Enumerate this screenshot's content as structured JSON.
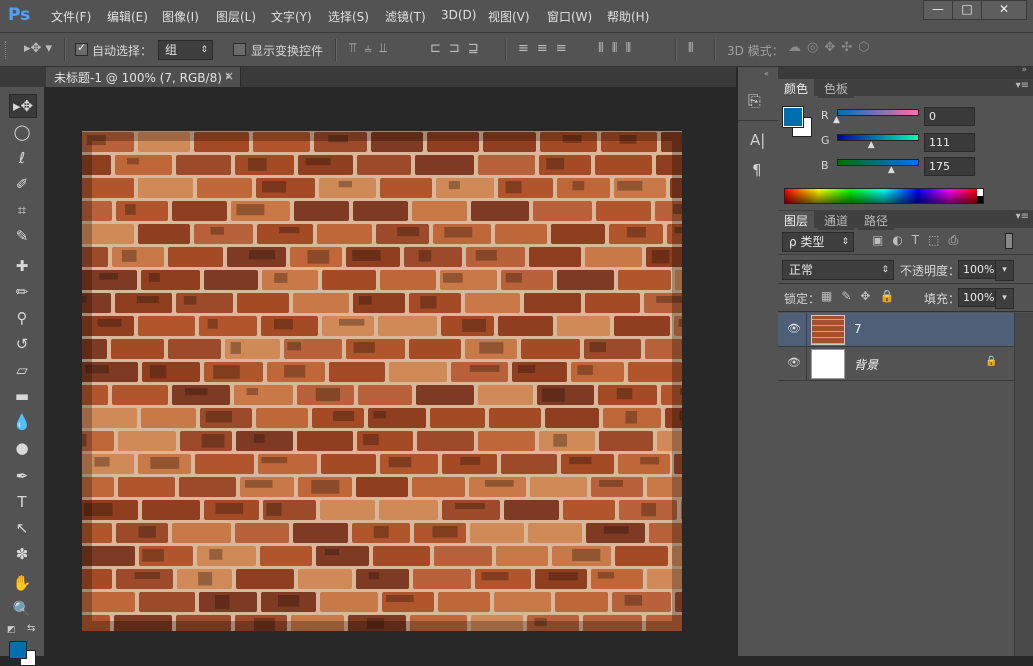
{
  "app": {
    "logo": "Ps"
  },
  "menu": [
    "文件(F)",
    "编辑(E)",
    "图像(I)",
    "图层(L)",
    "文字(Y)",
    "选择(S)",
    "滤镜(T)",
    "3D(D)",
    "视图(V)",
    "窗口(W)",
    "帮助(H)"
  ],
  "window_controls": {
    "minimize": "—",
    "maximize": "□",
    "close": "✕"
  },
  "options": {
    "auto_select_label": "自动选择：",
    "auto_select_checked": true,
    "target_value": "组",
    "show_transform_label": "显示变换控件",
    "mode_3d_label": "3D 模式："
  },
  "document": {
    "tab_title": "未标题-1 @ 100% (7, RGB/8) *",
    "close": "×"
  },
  "color_panel": {
    "tabs": [
      "颜色",
      "色板"
    ],
    "foreground": "#006faf",
    "background": "#ffffff",
    "channels": [
      {
        "label": "R",
        "value": "0",
        "level": 0.0
      },
      {
        "label": "G",
        "value": "111",
        "level": 0.435
      },
      {
        "label": "B",
        "value": "175",
        "level": 0.686
      }
    ]
  },
  "layers_panel": {
    "tabs": [
      "图层",
      "通道",
      "路径"
    ],
    "filter_label": "ρ 类型",
    "blend_mode": "正常",
    "opacity_label": "不透明度：",
    "opacity_value": "100%",
    "lock_label": "锁定：",
    "fill_label": "填充：",
    "fill_value": "100%",
    "layers": [
      {
        "name": "7",
        "selected": true,
        "locked": false
      },
      {
        "name": "背景",
        "selected": false,
        "locked": true
      }
    ]
  }
}
